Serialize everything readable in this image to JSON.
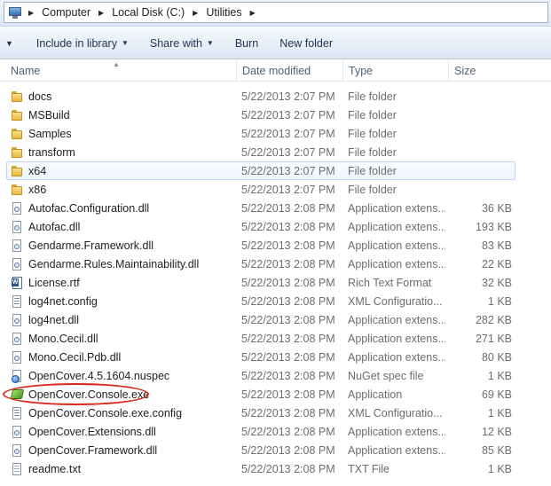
{
  "address": {
    "segments": [
      "Computer",
      "Local Disk (C:)",
      "Utilities"
    ]
  },
  "toolbar": {
    "include_label": "Include in library",
    "share_label": "Share with",
    "burn_label": "Burn",
    "new_folder_label": "New folder"
  },
  "columns": {
    "name": "Name",
    "date": "Date modified",
    "type": "Type",
    "size": "Size"
  },
  "files": [
    {
      "name": "docs",
      "date": "5/22/2013 2:07 PM",
      "type": "File folder",
      "size": "",
      "icon": "folder-icon"
    },
    {
      "name": "MSBuild",
      "date": "5/22/2013 2:07 PM",
      "type": "File folder",
      "size": "",
      "icon": "folder-icon"
    },
    {
      "name": "Samples",
      "date": "5/22/2013 2:07 PM",
      "type": "File folder",
      "size": "",
      "icon": "folder-icon"
    },
    {
      "name": "transform",
      "date": "5/22/2013 2:07 PM",
      "type": "File folder",
      "size": "",
      "icon": "folder-icon"
    },
    {
      "name": "x64",
      "date": "5/22/2013 2:07 PM",
      "type": "File folder",
      "size": "",
      "icon": "folder-icon"
    },
    {
      "name": "x86",
      "date": "5/22/2013 2:07 PM",
      "type": "File folder",
      "size": "",
      "icon": "folder-icon"
    },
    {
      "name": "Autofac.Configuration.dll",
      "date": "5/22/2013 2:08 PM",
      "type": "Application extens...",
      "size": "36 KB",
      "icon": "dll-icon"
    },
    {
      "name": "Autofac.dll",
      "date": "5/22/2013 2:08 PM",
      "type": "Application extens...",
      "size": "193 KB",
      "icon": "dll-icon"
    },
    {
      "name": "Gendarme.Framework.dll",
      "date": "5/22/2013 2:08 PM",
      "type": "Application extens...",
      "size": "83 KB",
      "icon": "dll-icon"
    },
    {
      "name": "Gendarme.Rules.Maintainability.dll",
      "date": "5/22/2013 2:08 PM",
      "type": "Application extens...",
      "size": "22 KB",
      "icon": "dll-icon"
    },
    {
      "name": "License.rtf",
      "date": "5/22/2013 2:08 PM",
      "type": "Rich Text Format",
      "size": "32 KB",
      "icon": "rtf-icon"
    },
    {
      "name": "log4net.config",
      "date": "5/22/2013 2:08 PM",
      "type": "XML Configuratio...",
      "size": "1 KB",
      "icon": "config-icon"
    },
    {
      "name": "log4net.dll",
      "date": "5/22/2013 2:08 PM",
      "type": "Application extens...",
      "size": "282 KB",
      "icon": "dll-icon"
    },
    {
      "name": "Mono.Cecil.dll",
      "date": "5/22/2013 2:08 PM",
      "type": "Application extens...",
      "size": "271 KB",
      "icon": "dll-icon"
    },
    {
      "name": "Mono.Cecil.Pdb.dll",
      "date": "5/22/2013 2:08 PM",
      "type": "Application extens...",
      "size": "80 KB",
      "icon": "dll-icon"
    },
    {
      "name": "OpenCover.4.5.1604.nuspec",
      "date": "5/22/2013 2:08 PM",
      "type": "NuGet spec file",
      "size": "1 KB",
      "icon": "nuspec-icon"
    },
    {
      "name": "OpenCover.Console.exe",
      "date": "5/22/2013 2:08 PM",
      "type": "Application",
      "size": "69 KB",
      "icon": "exe-icon"
    },
    {
      "name": "OpenCover.Console.exe.config",
      "date": "5/22/2013 2:08 PM",
      "type": "XML Configuratio...",
      "size": "1 KB",
      "icon": "config-icon"
    },
    {
      "name": "OpenCover.Extensions.dll",
      "date": "5/22/2013 2:08 PM",
      "type": "Application extens...",
      "size": "12 KB",
      "icon": "dll-icon"
    },
    {
      "name": "OpenCover.Framework.dll",
      "date": "5/22/2013 2:08 PM",
      "type": "Application extens...",
      "size": "85 KB",
      "icon": "dll-icon"
    },
    {
      "name": "readme.txt",
      "date": "5/22/2013 2:08 PM",
      "type": "TXT File",
      "size": "1 KB",
      "icon": "txt-icon"
    }
  ],
  "selected_index": 4,
  "annotation_color": "#d9261c"
}
